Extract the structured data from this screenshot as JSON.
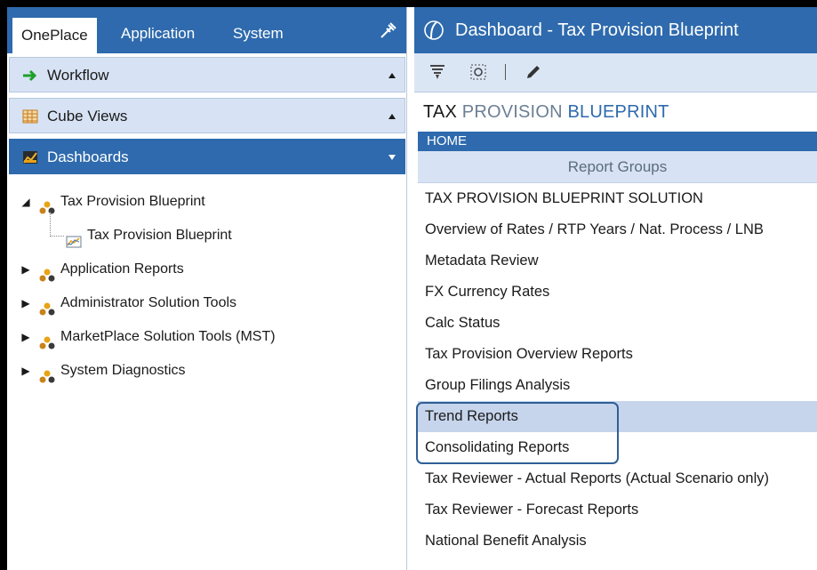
{
  "left": {
    "tabs": [
      {
        "label": "OnePlace"
      },
      {
        "label": "Application"
      },
      {
        "label": "System"
      }
    ],
    "sections": {
      "workflow": "Workflow",
      "cube_views": "Cube Views",
      "dashboards": "Dashboards"
    },
    "tree": [
      {
        "label": "Tax Provision Blueprint",
        "expanded": true,
        "icon": "group-icon"
      },
      {
        "label": "Tax Provision Blueprint",
        "child": true,
        "icon": "chart-icon"
      },
      {
        "label": "Application Reports",
        "icon": "group-icon"
      },
      {
        "label": "Administrator Solution Tools",
        "icon": "group-icon"
      },
      {
        "label": "MarketPlace Solution Tools (MST)",
        "icon": "group-icon"
      },
      {
        "label": "System Diagnostics",
        "icon": "group-icon"
      }
    ]
  },
  "right": {
    "title": "Dashboard - Tax Provision Blueprint",
    "bp_title": {
      "w1": "TAX",
      "w2": "PROVISION",
      "w3": "BLUEPRINT"
    },
    "home": "HOME",
    "report_groups": "Report Groups",
    "items": [
      "TAX PROVISION BLUEPRINT SOLUTION",
      "Overview of Rates / RTP Years / Nat. Process / LNB",
      "Metadata Review",
      "FX Currency Rates",
      "Calc Status",
      "Tax Provision Overview Reports",
      "Group Filings Analysis",
      "Trend Reports",
      "Consolidating Reports",
      "Tax Reviewer - Actual Reports  (Actual Scenario only)",
      "Tax Reviewer - Forecast Reports",
      "National Benefit Analysis"
    ],
    "selected_index": 7
  },
  "colors": {
    "brand_blue": "#2e6aad",
    "light_blue": "#d7e3f4",
    "selected_row": "#c6d5ec",
    "highlight_border": "#2f5f96"
  }
}
